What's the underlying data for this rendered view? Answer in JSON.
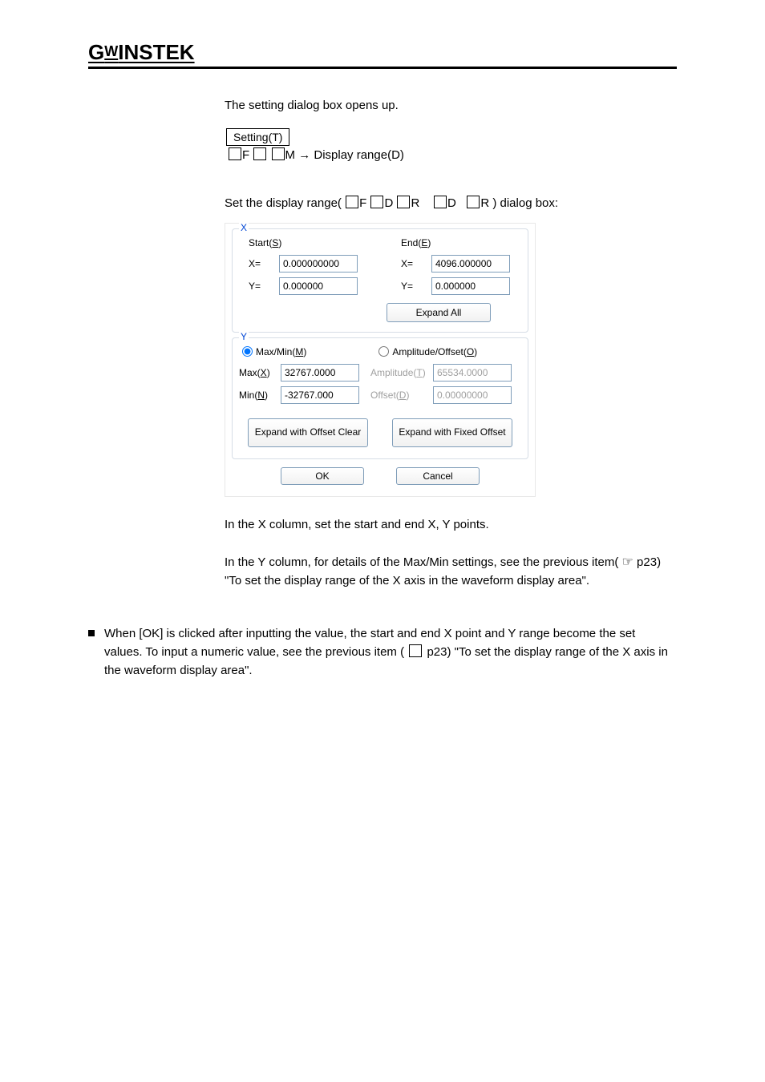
{
  "logo": "GWINSTEK",
  "intro": {
    "line1": "The setting dialog box opens up.",
    "nav_label": "Setting(T)",
    "nav_mnemonic_f": "F",
    "nav_mnemonic_m": "M",
    "arrow": "→",
    "nav_item": "Display range(D)"
  },
  "objective": {
    "text_before": "Set the display range(",
    "mnemonic_sequence": [
      "F",
      "D",
      "R",
      "",
      "D",
      "",
      "R"
    ],
    "text_after": ") dialog box:"
  },
  "dialog": {
    "x_group": {
      "legend": "X",
      "start": {
        "label": "Start(S)",
        "x_label": "X=",
        "x_value": "0.000000000",
        "y_label": "Y=",
        "y_value": "0.000000"
      },
      "end": {
        "label": "End(E)",
        "x_label": "X=",
        "x_value": "4096.000000",
        "y_label": "Y=",
        "y_value": "0.000000"
      },
      "expand_all": "Expand All"
    },
    "y_group": {
      "legend": "Y",
      "radio_maxmin": "Max/Min(M)",
      "radio_ampoff": "Amplitude/Offset(O)",
      "max_label": "Max(X)",
      "max_value": "32767.0000",
      "min_label": "Min(N)",
      "min_value": "-32767.000",
      "amp_label": "Amplitude(T)",
      "amp_value": "65534.0000",
      "off_label": "Offset(D)",
      "off_value": "0.00000000",
      "expand_offset_clear": "Expand with Offset Clear",
      "expand_fixed_offset": "Expand with Fixed Offset"
    },
    "ok": "OK",
    "cancel": "Cancel"
  },
  "explain": {
    "p1": "In the X column, set the start and end X, Y points.",
    "p2_a": "In the Y column, for details of the Max/Min settings, see the previous item(",
    "p2_b": "p23) \"To set the display range of the X axis in the waveform display area\"."
  },
  "bullet": {
    "text_a": "When [OK] is clicked after inputting the value, the start and end X point and Y range become the set values. To input a numeric value, see the previous item (",
    "text_b": " p23) \"To set the display range of the X axis in the waveform display area\"."
  }
}
